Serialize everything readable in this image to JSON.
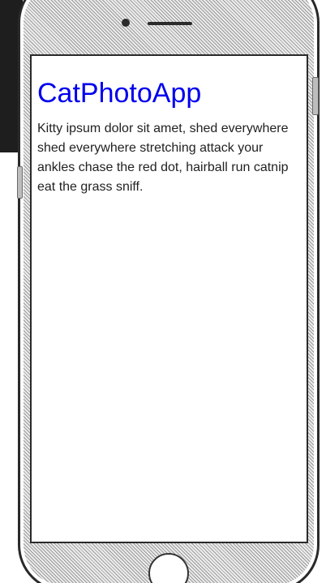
{
  "app": {
    "title": "CatPhotoApp",
    "intro": "Kitty ipsum dolor sit amet, shed everywhere shed everywhere stretching attack your ankles chase the red dot, hairball run catnip eat the grass sniff."
  },
  "colors": {
    "title": "#0000ee",
    "body_text": "#222222",
    "screen_background": "#ffffff",
    "device_frame": "#2a2a2a"
  },
  "device": {
    "icons": [
      "front-camera-icon",
      "speaker-grille-icon",
      "home-button-icon"
    ]
  }
}
